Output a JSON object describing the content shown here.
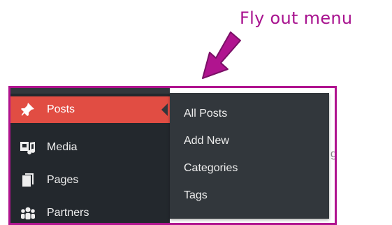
{
  "annotation": {
    "title": "Fly out menu",
    "color": "#b0148f"
  },
  "sidebar": {
    "background": "#23282d",
    "items": [
      {
        "label": "Posts",
        "icon": "pushpin-icon",
        "active": true
      },
      {
        "label": "Media",
        "icon": "media-icon",
        "active": false
      },
      {
        "label": "Pages",
        "icon": "pages-icon",
        "active": false
      },
      {
        "label": "Partners",
        "icon": "groups-icon",
        "active": false
      }
    ],
    "active_color": "#e14d43"
  },
  "flyout": {
    "background": "#32373c",
    "items": [
      {
        "label": "All Posts"
      },
      {
        "label": "Add New"
      },
      {
        "label": "Categories"
      },
      {
        "label": "Tags"
      }
    ]
  },
  "background_fragment": "g"
}
